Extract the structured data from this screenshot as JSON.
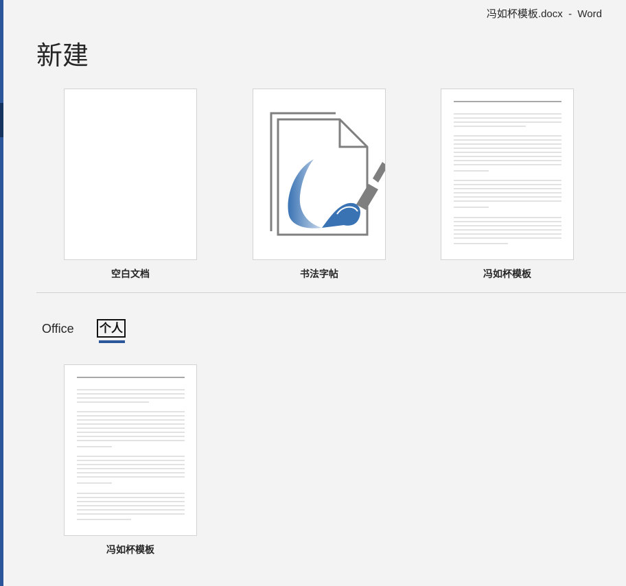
{
  "window": {
    "title": "冯如杯模板.docx  -  Word"
  },
  "page": {
    "title": "新建"
  },
  "featured_templates": [
    {
      "label": "空白文档",
      "thumbnail": "blank-page"
    },
    {
      "label": "书法字帖",
      "thumbnail": "calligraphy-brush-icon"
    },
    {
      "label": "冯如杯模板",
      "thumbnail": "text-document-preview"
    }
  ],
  "tabs": {
    "office_label": "Office",
    "personal_label": "个人",
    "selected": "personal"
  },
  "personal_templates": [
    {
      "label": "冯如杯模板",
      "thumbnail": "text-document-preview"
    }
  ],
  "colors": {
    "accent": "#2b579a",
    "background": "#f3f3f3",
    "brush_blue": "#3a73b4",
    "brush_handle": "#7f7f7f"
  }
}
